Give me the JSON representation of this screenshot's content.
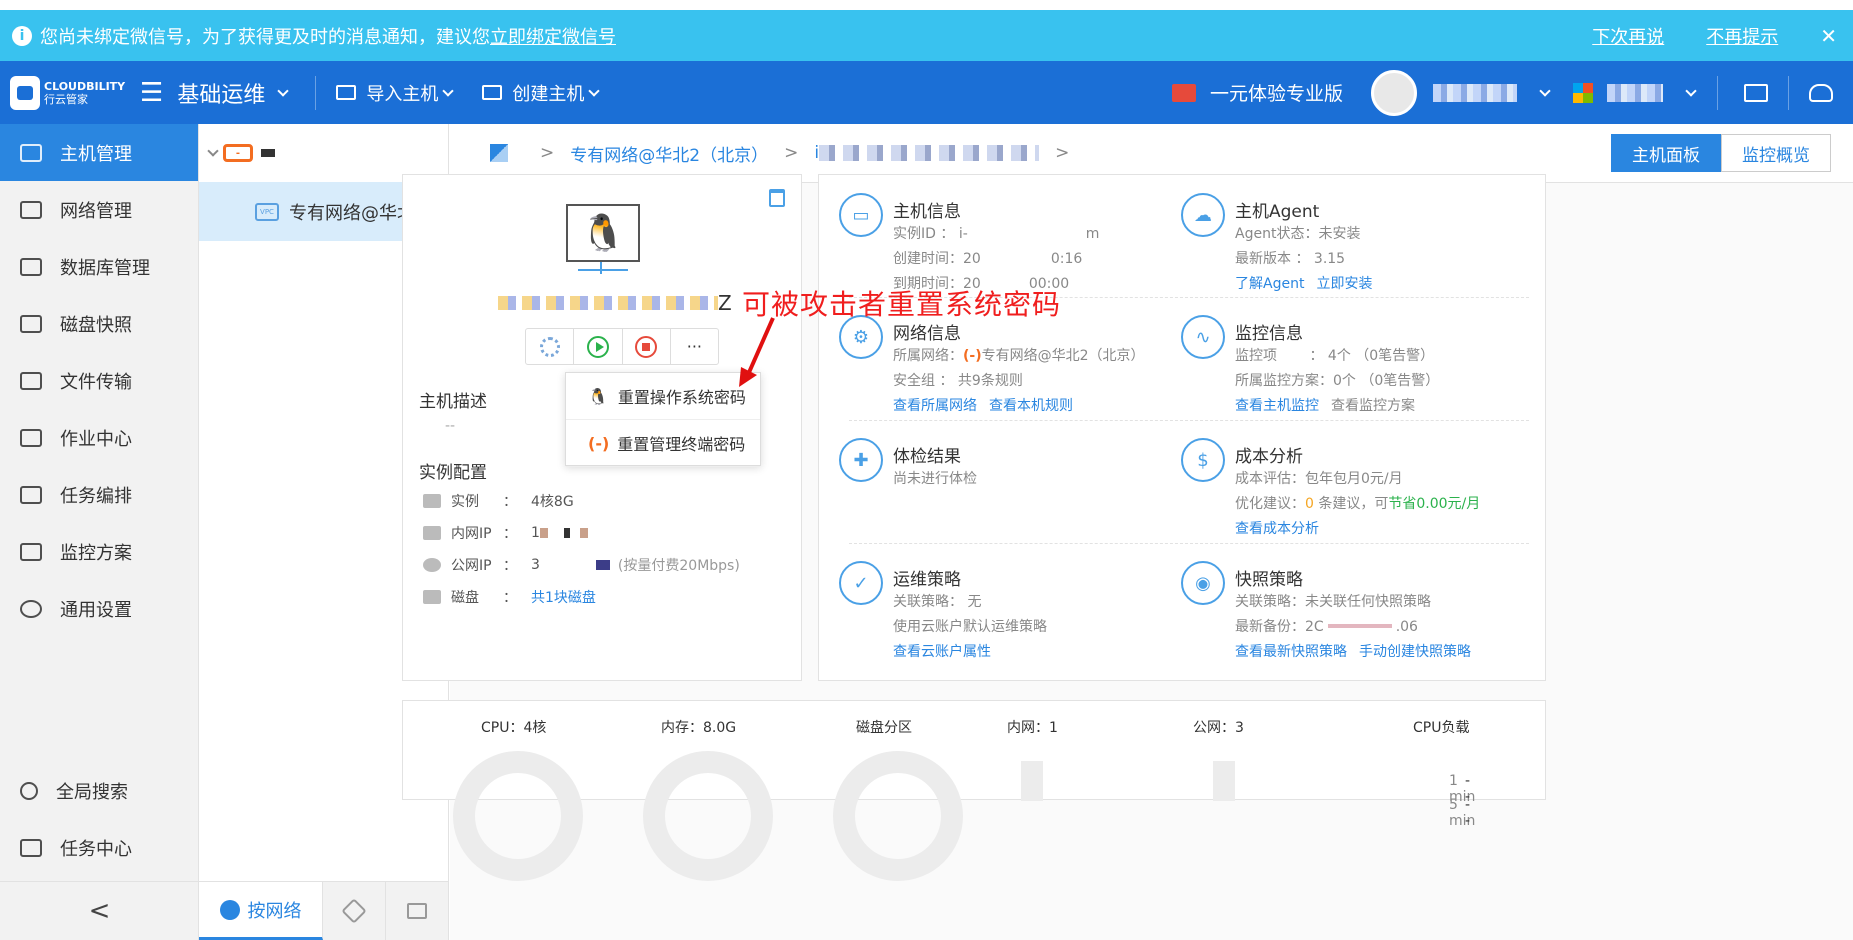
{
  "notice": {
    "text": "您尚未绑定微信号，为了获得更及时的消息通知，建议您",
    "link": "立即绑定微信号",
    "later": "下次再说",
    "never": "不再提示",
    "close": "✕"
  },
  "topbar": {
    "brand": "CLOUDBILITY",
    "brand_sub": "行云管家",
    "menu": "☰",
    "section": "基础运维",
    "import_host": "导入主机",
    "create_host": "创建主机",
    "promo": "一元体验专业版"
  },
  "sidebar": {
    "items": [
      {
        "label": "主机管理",
        "icon": "monitor-icon"
      },
      {
        "label": "网络管理",
        "icon": "network-icon"
      },
      {
        "label": "数据库管理",
        "icon": "database-icon"
      },
      {
        "label": "磁盘快照",
        "icon": "disk-icon"
      },
      {
        "label": "文件传输",
        "icon": "file-transfer-icon"
      },
      {
        "label": "作业中心",
        "icon": "clipboard-icon"
      },
      {
        "label": "任务编排",
        "icon": "task-icon"
      },
      {
        "label": "监控方案",
        "icon": "monitor-wave-icon"
      },
      {
        "label": "通用设置",
        "icon": "gear-icon"
      }
    ],
    "bottom": [
      {
        "label": "全局搜索",
        "icon": "search-icon"
      },
      {
        "label": "任务中心",
        "icon": "task-check-icon"
      }
    ],
    "fold": "<"
  },
  "tree": {
    "vpc": "专有网络@华北2...",
    "vpc_badge": "VPC",
    "tab_network": "按网络"
  },
  "breadcrumb": {
    "vpc": "专有网络@华北2（北京）",
    "prefix": "i"
  },
  "view_toggle": {
    "host_panel": "主机面板",
    "monitor": "监控概览"
  },
  "host_card": {
    "name_suffix": "Z",
    "more": "···",
    "desc_title": "主机描述",
    "desc_value": "--",
    "config_title": "实例配置",
    "rows": [
      {
        "key": "实例",
        "value": "4核8G"
      },
      {
        "key": "内网IP",
        "value": "1"
      },
      {
        "key": "公网IP",
        "value": "3",
        "extra": "(按量付费20Mbps)"
      },
      {
        "key": "磁盘",
        "value": "共1块磁盘"
      }
    ],
    "colon": "："
  },
  "dropdown": {
    "reset_os": "重置操作系统密码",
    "reset_term": "重置管理终端密码"
  },
  "annotation": "可被攻击者重置系统密码",
  "info": {
    "host_info": {
      "title": "主机信息",
      "id_label": "实例ID",
      "id_value": "i-",
      "id_tail": "m",
      "created_label": "创建时间",
      "created_value": "20",
      "created_tail": "0:16",
      "expire_label": "到期时间",
      "expire_value": "20",
      "expire_tail": "00:00"
    },
    "agent": {
      "title": "主机Agent",
      "status_label": "Agent状态：",
      "status_value": "未安装",
      "version_label": "最新版本",
      "version_value": "3.15",
      "learn": "了解Agent",
      "install": "立即安装"
    },
    "network": {
      "title": "网络信息",
      "vpc_label": "所属网络：",
      "vpc_value": "专有网络@华北2（北京）",
      "sg_label": "安全组",
      "sg_value": "共9条规则",
      "link1": "查看所属网络",
      "link2": "查看本机规则"
    },
    "monitor": {
      "title": "监控信息",
      "items_label": "监控项",
      "items_value": "4个 （0笔告警）",
      "plan_label": "所属监控方案：",
      "plan_value": "0个 （0笔告警）",
      "link1": "查看主机监控",
      "link2": "查看监控方案"
    },
    "check": {
      "title": "体检结果",
      "value": "尚未进行体检"
    },
    "cost": {
      "title": "成本分析",
      "eval_label": "成本评估：",
      "eval_value": "包年包月0元/月",
      "sug_label": "优化建议：",
      "sug_count": "0",
      "sug_mid": " 条建议，可",
      "sug_save": "节省0.00元/月",
      "link": "查看成本分析"
    },
    "ops": {
      "title": "运维策略",
      "rel_label": "关联策略：",
      "rel_value": "无",
      "note": "使用云账户默认运维策略",
      "link": "查看云账户属性"
    },
    "snapshot": {
      "title": "快照策略",
      "rel_label": "关联策略：",
      "rel_value": "未关联任何快照策略",
      "last_label": "最新备份：",
      "last_value": "2C",
      "last_tail": ".06",
      "link1": "查看最新快照策略",
      "link2": "手动创建快照策略"
    }
  },
  "stats": {
    "cpu": "CPU：4核",
    "mem": "内存：8.0G",
    "disk": "磁盘分区",
    "lan": "内网：1",
    "wan": "公网：3",
    "load": "CPU负载",
    "m1": "1 min",
    "m5": "5 min",
    "dash": "--"
  }
}
